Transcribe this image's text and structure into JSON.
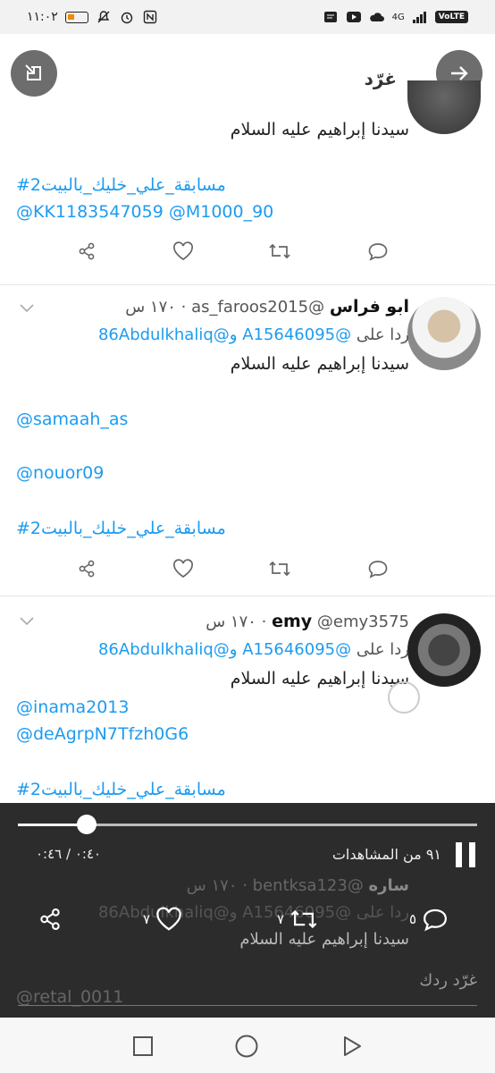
{
  "status_bar": {
    "time": "١١:٠٢",
    "network": "4G",
    "volte": "VoLTE"
  },
  "header": {
    "title": "غرّد"
  },
  "tweets": [
    {
      "text_line": "سيدنا إبراهيم عليه السلام",
      "hashtag": "#مسابقة_علي_خليك_بالبيت2",
      "mentions": "@KK1183547059 @M1000_90"
    },
    {
      "name": "ابو فراس",
      "handle": "@as_faroos2015",
      "time": "١٧٠ س",
      "reply_prefix": "ردا على",
      "reply_to": "@A15646095 و@86Abdulkhaliq",
      "text_line": "سيدنا إبراهيم عليه السلام",
      "mention1": "@samaah_as",
      "mention2": "@nouor09",
      "hashtag": "#مسابقة_علي_خليك_بالبيت2"
    },
    {
      "name": "emy",
      "handle": "@emy3575",
      "time": "١٧٠ س",
      "reply_prefix": "ردا على",
      "reply_to": "@A15646095 و@86Abdulkhaliq",
      "text_line": "سيدنا إبراهيم عليه السلام",
      "mention1": "@inama2013",
      "mention2": "@deAgrpN7Tfzh0G6",
      "hashtag": "#مسابقة_علي_خليك_بالبيت2"
    },
    {
      "name": "ساره",
      "handle": "@bentksa123",
      "time": "١٧٠ س",
      "reply_prefix": "ردا على",
      "reply_to": "@A15646095 و@86Abdulkhaliq",
      "text_line": "سيدنا إبراهيم عليه السلام",
      "mention1": "@retal_0011"
    }
  ],
  "video": {
    "progress": 0.149,
    "time_display": "٠:٤٠ / ٠:٤٦",
    "views": "٩١ من المشاهدات",
    "reply_count": "٥",
    "retweet_count": "٧",
    "like_count": "٧",
    "reply_placeholder": "غرّد ردك"
  },
  "colors": {
    "link": "#1d9bf0",
    "overlay": "#1c1c1c",
    "battery": "#f08a00"
  }
}
